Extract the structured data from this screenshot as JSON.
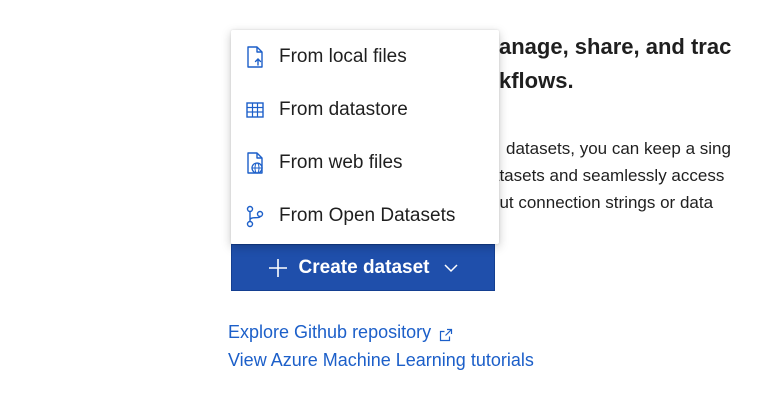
{
  "hero": {
    "heading_line1": "Manage, share, and track",
    "heading_line2": "workflows.",
    "heading_visible_line1": "anage, share, and trac",
    "heading_visible_line2": "kflows.",
    "body_visible_line1": "datasets, you can keep a sing",
    "body_visible_line2": "atasets and seamlessly access",
    "body_visible_line3": "out connection strings or data"
  },
  "menu": {
    "items": [
      {
        "label": "From local files",
        "icon": "local-file-icon"
      },
      {
        "label": "From datastore",
        "icon": "table-icon"
      },
      {
        "label": "From web files",
        "icon": "web-file-icon"
      },
      {
        "label": "From Open Datasets",
        "icon": "branch-icon"
      }
    ]
  },
  "create_button": {
    "label": "Create dataset",
    "icon": "plus-icon",
    "dropdown_icon": "chevron-down-icon"
  },
  "links": {
    "github": "Explore Github repository",
    "github_icon": "external-link-icon",
    "tutorials": "View Azure Machine Learning tutorials"
  },
  "colors": {
    "primary": "#1f4fab",
    "link": "#1c5fc9",
    "icon": "#1c5fc9"
  }
}
